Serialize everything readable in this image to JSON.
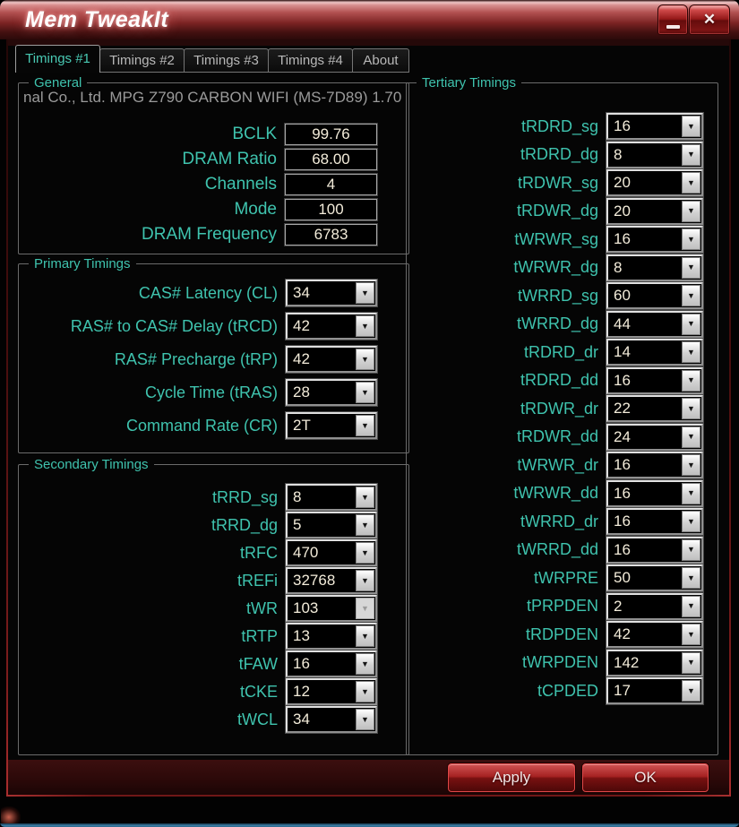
{
  "window": {
    "title": "Mem TweakIt"
  },
  "icons": {
    "close": "✕",
    "dropdown": "▼",
    "minimize": "—"
  },
  "colors": {
    "accent_teal": "#3FC3AE",
    "value_text": "#F3ECDA",
    "info_text": "#9A9A9A",
    "tab_inactive_text": "#B8B8B8",
    "button_red": "#A62222",
    "footer_red": "#3C0F0F",
    "bottom_edge_blue": "#3D83AD"
  },
  "tabs": [
    {
      "label": "Timings #1",
      "active": true
    },
    {
      "label": "Timings #2"
    },
    {
      "label": "Timings #3"
    },
    {
      "label": "Timings #4"
    },
    {
      "label": "About"
    }
  ],
  "general": {
    "title": "General",
    "info": "nal Co., Ltd. MPG Z790 CARBON WIFI (MS-7D89) 1.70",
    "fields": [
      {
        "label": "BCLK",
        "value": "99.76"
      },
      {
        "label": "DRAM Ratio",
        "value": "68.00"
      },
      {
        "label": "Channels",
        "value": "4"
      },
      {
        "label": "Mode",
        "value": "100"
      },
      {
        "label": "DRAM Frequency",
        "value": "6783"
      }
    ]
  },
  "primary": {
    "title": "Primary Timings",
    "fields": [
      {
        "label": "CAS# Latency (CL)",
        "value": "34"
      },
      {
        "label": "RAS# to CAS# Delay (tRCD)",
        "value": "42"
      },
      {
        "label": "RAS# Precharge (tRP)",
        "value": "42"
      },
      {
        "label": "Cycle Time (tRAS)",
        "value": "28"
      },
      {
        "label": "Command Rate (CR)",
        "value": "2T"
      }
    ]
  },
  "secondary": {
    "title": "Secondary Timings",
    "fields": [
      {
        "label": "tRRD_sg",
        "value": "8"
      },
      {
        "label": "tRRD_dg",
        "value": "5"
      },
      {
        "label": "tRFC",
        "value": "470"
      },
      {
        "label": "tREFi",
        "value": "32768"
      },
      {
        "label": "tWR",
        "value": "103",
        "disabled": true
      },
      {
        "label": "tRTP",
        "value": "13"
      },
      {
        "label": "tFAW",
        "value": "16"
      },
      {
        "label": "tCKE",
        "value": "12"
      },
      {
        "label": "tWCL",
        "value": "34"
      }
    ]
  },
  "tertiary": {
    "title": "Tertiary Timings",
    "fields": [
      {
        "label": "tRDRD_sg",
        "value": "16"
      },
      {
        "label": "tRDRD_dg",
        "value": "8"
      },
      {
        "label": "tRDWR_sg",
        "value": "20"
      },
      {
        "label": "tRDWR_dg",
        "value": "20"
      },
      {
        "label": "tWRWR_sg",
        "value": "16"
      },
      {
        "label": "tWRWR_dg",
        "value": "8"
      },
      {
        "label": "tWRRD_sg",
        "value": "60"
      },
      {
        "label": "tWRRD_dg",
        "value": "44"
      },
      {
        "label": "tRDRD_dr",
        "value": "14"
      },
      {
        "label": "tRDRD_dd",
        "value": "16"
      },
      {
        "label": "tRDWR_dr",
        "value": "22"
      },
      {
        "label": "tRDWR_dd",
        "value": "24"
      },
      {
        "label": "tWRWR_dr",
        "value": "16"
      },
      {
        "label": "tWRWR_dd",
        "value": "16"
      },
      {
        "label": "tWRRD_dr",
        "value": "16"
      },
      {
        "label": "tWRRD_dd",
        "value": "16"
      },
      {
        "label": "tWRPRE",
        "value": "50"
      },
      {
        "label": "tPRPDEN",
        "value": "2"
      },
      {
        "label": "tRDPDEN",
        "value": "42"
      },
      {
        "label": "tWRPDEN",
        "value": "142"
      },
      {
        "label": "tCPDED",
        "value": "17"
      }
    ]
  },
  "footer": {
    "apply_label": "Apply",
    "ok_label": "OK"
  }
}
